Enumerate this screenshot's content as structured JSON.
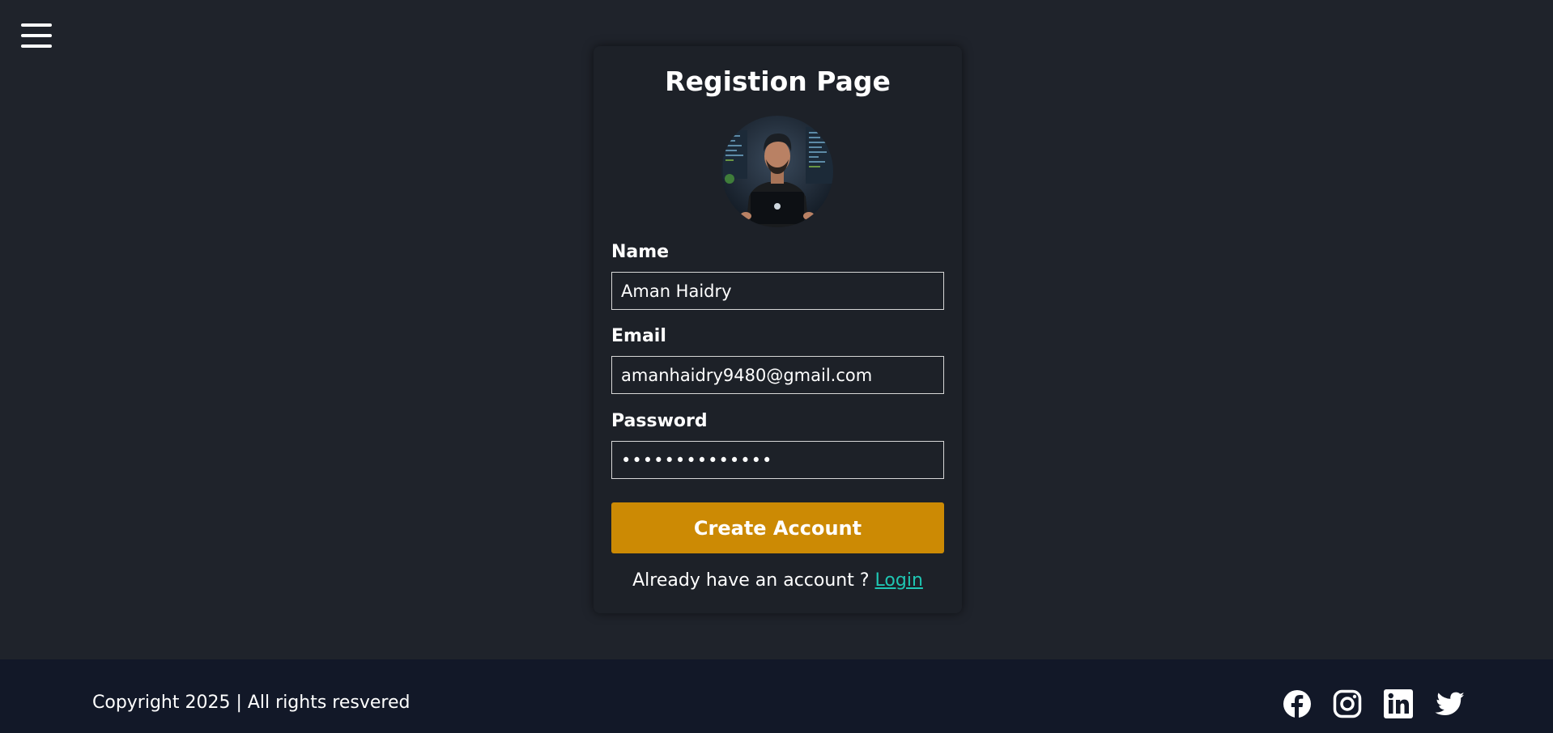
{
  "header": {
    "menu_icon": "hamburger-menu-icon"
  },
  "form": {
    "title": "Registion Page",
    "avatar_alt": "profile-avatar",
    "name_label": "Name",
    "name_value": "Aman Haidry",
    "email_label": "Email",
    "email_value": "amanhaidry9480@gmail.com",
    "password_label": "Password",
    "password_value": "••••••••••••••",
    "submit_label": "Create Account",
    "login_prompt": "Already have an account ? ",
    "login_link": "Login"
  },
  "footer": {
    "copyright": "Copyright 2025 | All rights resvered",
    "social_icons": [
      "facebook-icon",
      "instagram-icon",
      "linkedin-icon",
      "twitter-icon"
    ]
  },
  "colors": {
    "background": "#1f232b",
    "card": "#1d2128",
    "accent_button": "#cc8a04",
    "link": "#1fc6b3",
    "footer": "#121828"
  }
}
